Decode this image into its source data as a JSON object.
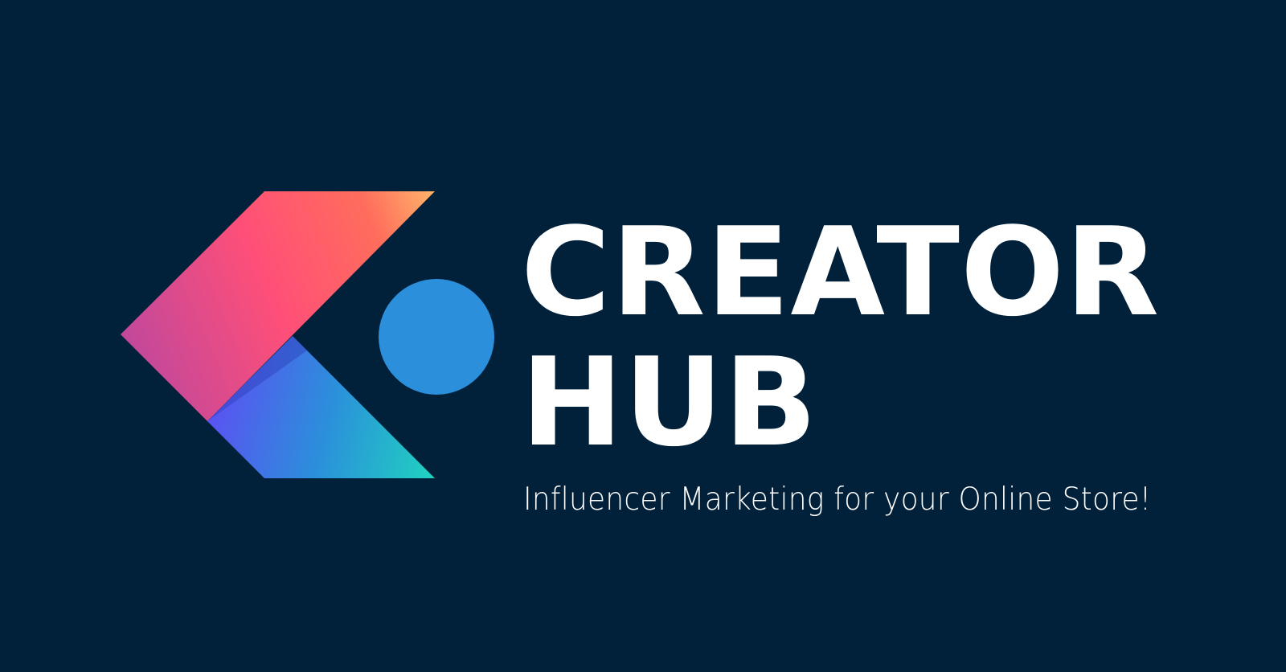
{
  "brand": {
    "title_line_1": "CREATOR",
    "title_line_2": "HUB",
    "tagline": "Influencer Marketing for your Online Store!",
    "logo_icon": "creator-hub-logo-icon"
  },
  "colors": {
    "background": "#01213a",
    "text": "#ffffff",
    "dot": "#2b8fdb",
    "upper_gradient": [
      "#c2489b",
      "#ff4f78",
      "#ff6d5c",
      "#ffb36a"
    ],
    "lower_gradient": [
      "#5b52f2",
      "#2b8fdb",
      "#20d1c0"
    ]
  }
}
